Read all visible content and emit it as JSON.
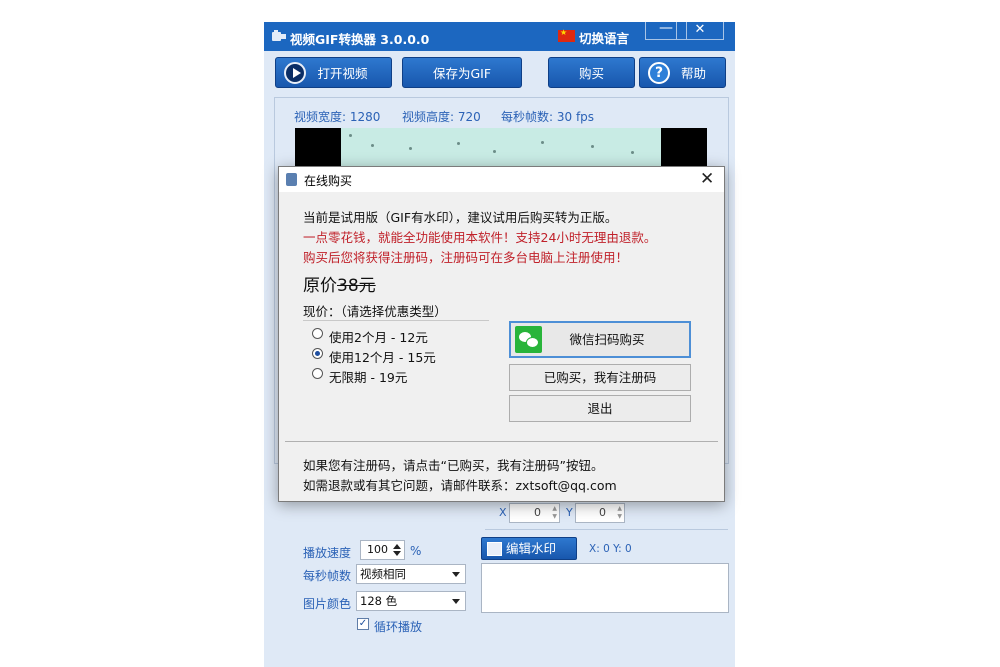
{
  "app": {
    "title": "视频GIF转换器 3.0.0.0",
    "language_label": "切换语言",
    "min_icon": "minimize-icon",
    "close_icon": "close-icon"
  },
  "toolbar": {
    "open_label": "打开视频",
    "save_label": "保存为GIF",
    "buy_label": "购买",
    "help_label": "帮助",
    "help_glyph": "?"
  },
  "video_info": {
    "width_label": "视频宽度: 1280",
    "height_label": "视频高度: 720",
    "fps_label": "每秒帧数: 30 fps"
  },
  "offset": {
    "x_label": "X",
    "x_value": "0",
    "y_label": "Y",
    "y_value": "0"
  },
  "settings": {
    "speed_label": "播放速度",
    "speed_value": "100",
    "speed_unit": "%",
    "fps_label": "每秒帧数",
    "fps_value": "视频相同",
    "color_label": "图片颜色",
    "color_value": "128 色",
    "loop_label": "循环播放",
    "loop_checked": true,
    "loop_mark": "✓"
  },
  "watermark": {
    "button_label": "编辑水印",
    "coords": "X: 0  Y: 0"
  },
  "dialog": {
    "title": "在线购买",
    "close_glyph": "✕",
    "line1": "当前是试用版（GIF有水印），建议试用后购买转为正版。",
    "line2": "一点零花钱，就能全功能使用本软件！支持24小时无理由退款。",
    "line3": "购买后您将获得注册码，注册码可在多台电脑上注册使用！",
    "orig_price_prefix": "原价",
    "orig_price_value": "38元",
    "current_price_label": "现价：（请选择优惠类型）",
    "options": [
      {
        "label": "使用2个月 - 12元",
        "selected": false
      },
      {
        "label": "使用12个月 - 15元",
        "selected": true
      },
      {
        "label": "无限期 - 19元",
        "selected": false
      }
    ],
    "wechat_button": "微信扫码购买",
    "registered_button": "已购买，我有注册码",
    "exit_button": "退出",
    "footer1": "如果您有注册码，请点击“已购买，我有注册码”按钮。",
    "footer2": "如需退款或有其它问题，请邮件联系：zxtsoft@qq.com"
  },
  "colors": {
    "titlebar": "#1c67c0",
    "button_blue": "#1f63be",
    "label_blue": "#2b62b6",
    "notice_red": "#c0212a",
    "wechat_green": "#28b43a"
  }
}
